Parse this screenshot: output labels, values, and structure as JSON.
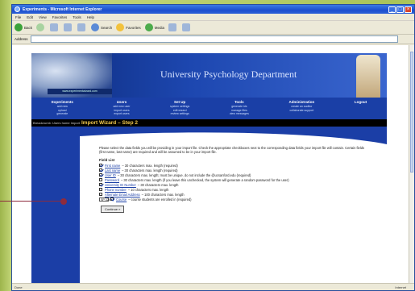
{
  "window": {
    "title": "Experiments - Microsoft Internet Explorer",
    "menu": [
      "File",
      "Edit",
      "View",
      "Favorites",
      "Tools",
      "Help"
    ],
    "toolbar": {
      "back": "Back",
      "search": "Search",
      "favorites": "Favorites",
      "media": "Media"
    },
    "address_label": "Address",
    "status_text": "Done",
    "status_zone": "Internet"
  },
  "site": {
    "department": "University Psychology Department",
    "logo_text": "www.experimentwizard.com",
    "nav": [
      {
        "head": "Experiments",
        "subs": [
          "add new",
          "upload",
          "generate"
        ]
      },
      {
        "head": "Users",
        "subs": [
          "add new user",
          "import users",
          "export users"
        ]
      },
      {
        "head": "Set Up",
        "subs": [
          "system settings",
          "edit wizard",
          "review settings"
        ]
      },
      {
        "head": "Tools",
        "subs": [
          "generate ids",
          "manage files",
          "view messages"
        ]
      },
      {
        "head": "Administration",
        "subs": [
          "create an auditor",
          "collaborate support"
        ]
      },
      {
        "head": "Logout",
        "subs": []
      }
    ],
    "breadcrumb": "Breadcrumb: Users home Import",
    "wizard_title": "Import Wizard – Step 2"
  },
  "form": {
    "intro": "Please select the data fields you will be providing in your import file. Check the appropriate checkboxes next to the corresponding data fields your import file will contain. Certain fields (first name, last name) are required and will be assumed to be in your import file.",
    "field_list_heading": "Field List",
    "fields": [
      {
        "checked": true,
        "label": "First name",
        "desc": "– 30 characters max. length (required)"
      },
      {
        "checked": true,
        "label": "Last name",
        "desc": "– 30 characters max. length (required)"
      },
      {
        "checked": true,
        "label": "User ID",
        "desc": "– 30 characters max. length; must be unique. do not include the @ucsanford.edu (required)"
      },
      {
        "checked": false,
        "label": "Password",
        "desc": "– 30 characters max. length (if you leave this unchecked, the system will generate a random password for the user)"
      },
      {
        "checked": true,
        "label": "University ID Number",
        "desc": "– 30 characters max. length"
      },
      {
        "checked": false,
        "label": "Phone number",
        "desc": "– 10 characters max. length"
      },
      {
        "checked": false,
        "label": "Alternate Email Address",
        "desc": "– 100 characters max. length"
      }
    ],
    "course_select": "SP 325",
    "course_label": "Course",
    "course_desc": "– course students are enrolled in (required)",
    "continue_label": "Continue »"
  }
}
